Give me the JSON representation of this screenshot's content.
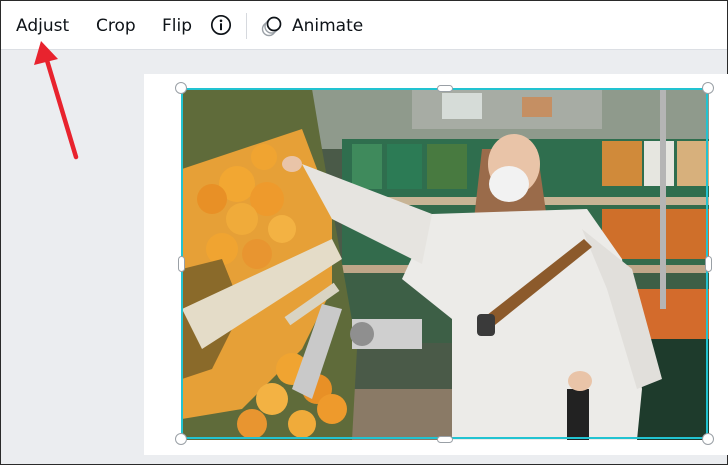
{
  "toolbar": {
    "adjust_label": "Adjust",
    "crop_label": "Crop",
    "flip_label": "Flip",
    "info_icon": "info-icon",
    "animate_icon": "animate-icon",
    "animate_label": "Animate"
  },
  "colors": {
    "selection": "#22c3d1",
    "annotation_arrow": "#e8232e",
    "workspace": "#ebedf0",
    "toolbar_bg": "#ffffff"
  },
  "canvas": {
    "image_subject": "woman in white sweatshirt and face mask picking oranges in a supermarket produce aisle"
  }
}
